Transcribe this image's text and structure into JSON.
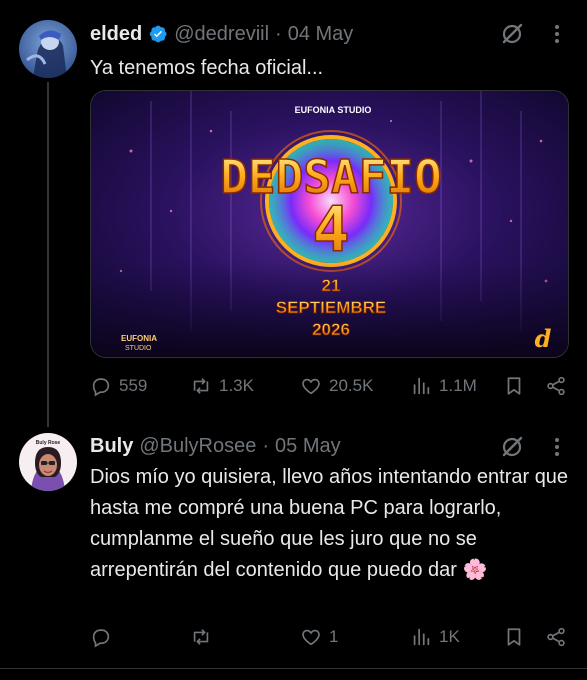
{
  "tweet1": {
    "name": "elded",
    "handle": "@dedreviil",
    "separator": "·",
    "date": "04 May",
    "text": "Ya tenemos fecha oficial...",
    "media": {
      "studio_top": "EUFONIA STUDIO",
      "title_line1": "DEDSAFIO",
      "title_line2": "4",
      "date_line1": "21",
      "date_line2": "SEPTIEMBRE",
      "date_line3": "2026",
      "studio_bottom_1": "EUFONIA",
      "studio_bottom_2": "STUDIO",
      "corner_logo": "d"
    },
    "stats": {
      "replies": "559",
      "retweets": "1.3K",
      "likes": "20.5K",
      "views": "1.1M"
    }
  },
  "tweet2": {
    "name": "Buly",
    "handle": "@BulyRosee",
    "separator": "·",
    "date": "05 May",
    "avatar_label": "Buly Rose",
    "text": "Dios mío yo quisiera, llevo años intentando entrar que hasta me compré una buena PC para lograrlo, cumplanme el sueño que les juro que no se arrepentirán del contenido que puedo dar 🌸",
    "stats": {
      "replies": "",
      "retweets": "",
      "likes": "1",
      "views": "1K"
    }
  },
  "colors": {
    "background": "#000000",
    "text": "#e7e9ea",
    "muted": "#71767b",
    "verified": "#1d9bf0",
    "divider": "#2f3336"
  }
}
